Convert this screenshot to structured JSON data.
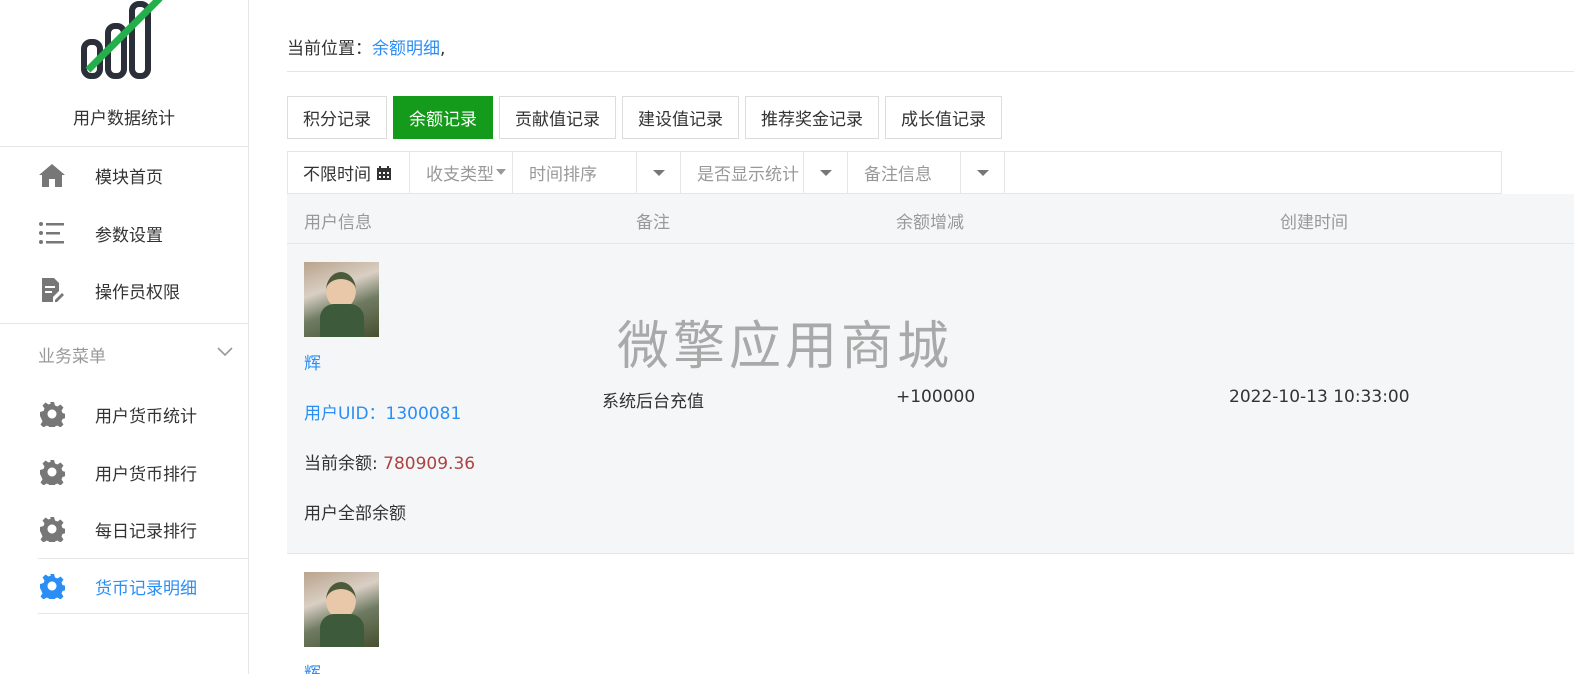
{
  "sidebar": {
    "app_title": "用户数据统计",
    "top_items": [
      {
        "label": "模块首页",
        "icon": "home-icon"
      },
      {
        "label": "参数设置",
        "icon": "list-settings-icon"
      },
      {
        "label": "操作员权限",
        "icon": "document-edit-icon"
      }
    ],
    "section_title": "业务菜单",
    "section_items": [
      {
        "label": "用户货币统计",
        "icon": "gear-icon"
      },
      {
        "label": "用户货币排行",
        "icon": "gear-icon"
      },
      {
        "label": "每日记录排行",
        "icon": "gear-icon"
      },
      {
        "label": "货币记录明细",
        "icon": "gear-icon",
        "active": true
      }
    ]
  },
  "breadcrumb": {
    "prefix": "当前位置：",
    "link": "余额明细",
    "suffix": ","
  },
  "tabs": [
    {
      "label": "积分记录"
    },
    {
      "label": "余额记录",
      "active": true
    },
    {
      "label": "贡献值记录"
    },
    {
      "label": "建设值记录"
    },
    {
      "label": "推荐奖金记录"
    },
    {
      "label": "成长值记录"
    }
  ],
  "filters": {
    "date": "不限时间",
    "type_placeholder": "收支类型",
    "sort_placeholder": "时间排序",
    "show_stats_placeholder": "是否显示统计",
    "remark_placeholder": "备注信息"
  },
  "table": {
    "headers": [
      "用户信息",
      "备注",
      "余额增减",
      "创建时间"
    ],
    "rows": [
      {
        "name": "辉",
        "uid_label": "用户UID：",
        "uid": "1300081",
        "balance_label": "当前余额: ",
        "balance": "780909.36",
        "all_balance": "用户全部余额",
        "remark": "系统后台充值",
        "change": "+100000",
        "created": "2022-10-13 10:33:00"
      },
      {
        "name": "辉"
      }
    ]
  },
  "watermark": "微擎应用商城",
  "colors": {
    "accent": "#2b8ef5",
    "active_tab": "#159b1b",
    "balance_value": "#a94442"
  }
}
